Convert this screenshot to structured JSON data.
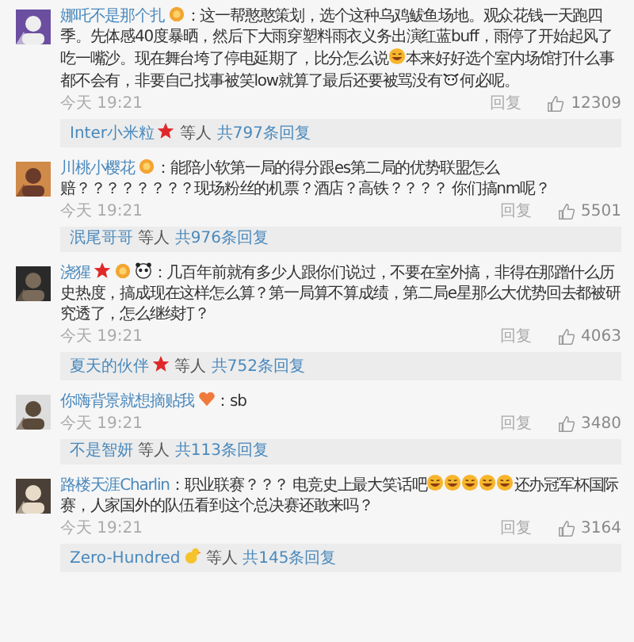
{
  "comments": [
    {
      "name": "娜吒不是那个扎",
      "badges": [
        {
          "kind": "vip"
        }
      ],
      "body": [
        {
          "kind": "text",
          "text": "：这一帮憨憨策划，选个这种乌鸡鲅鱼场地。观众花钱一天跑四季。先体感40度暴晒，然后下大雨穿塑料雨衣义务出演红蓝buff，雨停了开始起风了吃一嘴沙。现在舞台垮了停电延期了，比分怎么说"
        },
        {
          "kind": "emoji"
        },
        {
          "kind": "text",
          "text": "本来好好选个室内场馆打什么事都不会有，非要自己找事被笑low就算了最后还要被骂没有"
        },
        {
          "kind": "cow"
        },
        {
          "kind": "text",
          "text": "何必呢。"
        }
      ],
      "time": "今天 19:21",
      "reply": "回复",
      "likes": "12309",
      "replies": {
        "name": "Inter小米粒",
        "badges": [
          {
            "kind": "star"
          }
        ],
        "etc": "等人",
        "count": "共797条回复"
      }
    },
    {
      "name": "川桃小樱花",
      "badges": [
        {
          "kind": "vip"
        }
      ],
      "body": [
        {
          "kind": "text",
          "text": "：能陪小软第一局的得分跟es第二局的优势联盟怎么赔？？？？？？？？现场粉丝的机票？酒店？高铁？？？？ 你们搞nm呢？"
        }
      ],
      "time": "今天 19:21",
      "reply": "回复",
      "likes": "5501",
      "replies": {
        "name": "泯尾哥哥",
        "etc": "等人",
        "count": "共976条回复"
      }
    },
    {
      "name": "浇猩",
      "badges": [
        {
          "kind": "star"
        },
        {
          "kind": "vip"
        },
        {
          "kind": "panda"
        }
      ],
      "body": [
        {
          "kind": "text",
          "text": "：几百年前就有多少人跟你们说过，不要在室外搞，非得在那蹭什么历史热度，搞成现在这样怎么算？第一局算不算成绩，第二局e星那么大优势回去都被研究透了，怎么继续打？"
        }
      ],
      "time": "今天 19:21",
      "reply": "回复",
      "likes": "4063",
      "replies": {
        "name": "夏天的伙伴",
        "badges": [
          {
            "kind": "star"
          }
        ],
        "etc": "等人",
        "count": "共752条回复"
      }
    },
    {
      "name": "你嗨背景就想摘贴我",
      "badges": [
        {
          "kind": "heart"
        }
      ],
      "body": [
        {
          "kind": "text",
          "text": "：sb"
        }
      ],
      "time": "今天 19:21",
      "reply": "回复",
      "likes": "3480",
      "replies": {
        "name": "不是智妍",
        "etc": "等人",
        "count": "共113条回复"
      }
    },
    {
      "name": "路楼天涯Charlin",
      "body": [
        {
          "kind": "text",
          "text": "：职业联赛？？？ 电竞史上最大笑话吧"
        },
        {
          "kind": "emoji"
        },
        {
          "kind": "emoji"
        },
        {
          "kind": "emoji"
        },
        {
          "kind": "emoji"
        },
        {
          "kind": "emoji"
        },
        {
          "kind": "text",
          "text": "还办冠军杯国际赛，人家国外的队伍看到这个总决赛还敢来吗？"
        }
      ],
      "time": "今天 19:21",
      "reply": "回复",
      "likes": "3164",
      "replies": {
        "name": "Zero-Hundred",
        "badges": [
          {
            "kind": "duck"
          }
        ],
        "etc": "等人",
        "count": "共145条回复"
      }
    }
  ]
}
